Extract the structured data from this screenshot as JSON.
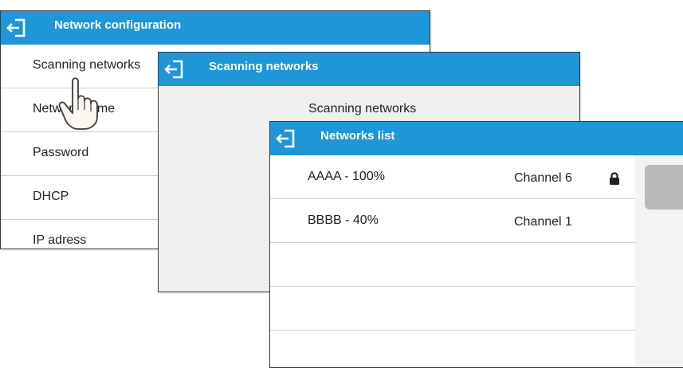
{
  "network_config": {
    "title": "Network configuration",
    "items": [
      {
        "label": "Scanning networks"
      },
      {
        "label": "Network name"
      },
      {
        "label": "Password"
      },
      {
        "label": "DHCP"
      },
      {
        "label": "IP adress"
      }
    ]
  },
  "scanning_networks": {
    "title": "Scanning networks",
    "subtitle": "Scanning networks"
  },
  "networks_list": {
    "title": "Networks list",
    "items": [
      {
        "name": "AAAA - 100%",
        "channel": "Channel 6",
        "locked": true
      },
      {
        "name": "BBBB - 40%",
        "channel": "Channel 1",
        "locked": false
      }
    ]
  },
  "colors": {
    "titlebar": "#1e96d8",
    "panel_bg": "#efefef",
    "scrollbar": "#b9b9b9"
  },
  "icons": {
    "back": "back-arrow-icon",
    "lock": "lock-icon",
    "pointer": "hand-pointer-icon"
  }
}
